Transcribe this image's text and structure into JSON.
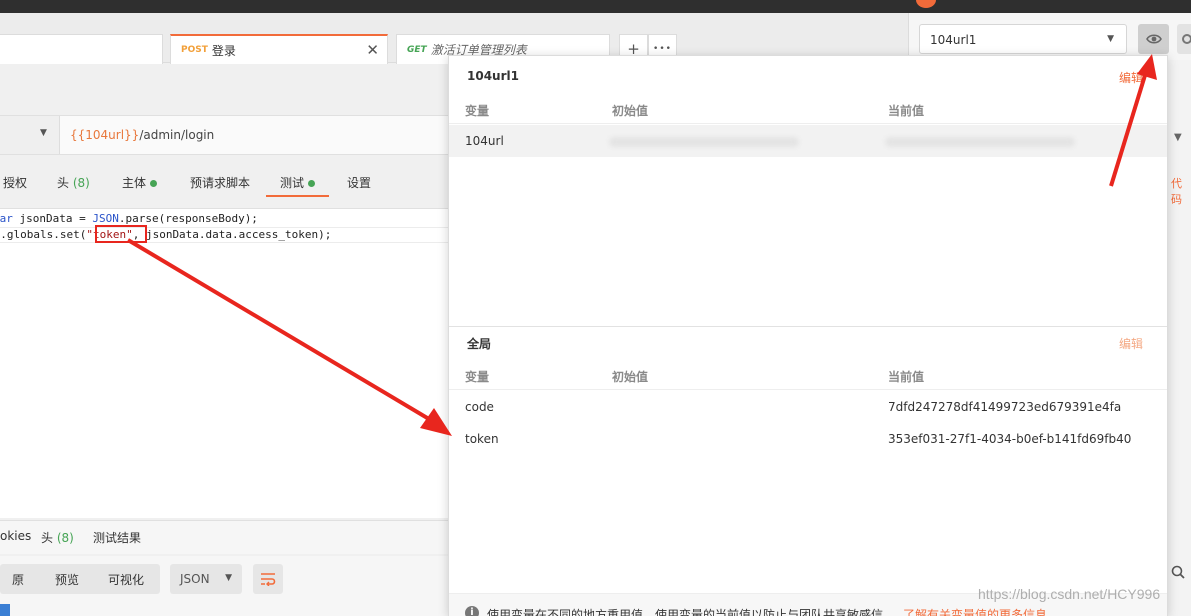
{
  "tabs": [
    {
      "method": "POST",
      "name": "登录",
      "active": true
    },
    {
      "method": "GET",
      "name": "激活订单管理列表",
      "active": false
    }
  ],
  "tab_close_glyph": "✕",
  "tab_add_glyph": "+",
  "tab_more_glyph": "•••",
  "request": {
    "url_var": "{{104url}}",
    "url_path": "/admin/login"
  },
  "request_tabs": {
    "auth": "授权",
    "headers": "头",
    "headers_count": "(8)",
    "body": "主体",
    "prerequest": "预请求脚本",
    "tests": "测试",
    "settings": "设置"
  },
  "code": {
    "line1_kw": "var",
    "line1_a": " jsonData = ",
    "line1_obj": "JSON",
    "line1_b": ".parse(responseBody);",
    "line2_a": "pm.globals.set(",
    "line2_str": "\"token\"",
    "line2_b": ", jsonData.data.access_token);"
  },
  "response_tabs": {
    "cookies": "okies",
    "headers": "头",
    "headers_count": "(8)",
    "test_results": "测试结果"
  },
  "response_tools": {
    "raw": "原",
    "preview": "预览",
    "visualize": "可视化",
    "format": "JSON"
  },
  "environment": {
    "selected": "104url1"
  },
  "popover": {
    "env_title": "104url1",
    "edit_label": "编辑",
    "col_variable": "变量",
    "col_initial": "初始值",
    "col_current": "当前值",
    "env_rows": [
      {
        "variable": "104url"
      }
    ],
    "globals_title": "全局",
    "global_rows": [
      {
        "variable": "code",
        "initial": "",
        "current": "7dfd247278df41499723ed679391e4fa"
      },
      {
        "variable": "token",
        "initial": "",
        "current": "353ef031-27f1-4034-b0ef-b141fd69fb40"
      }
    ],
    "footer_text": "使用变量在不同的地方重用值。使用变量的当前值以防止与团队共享敏感信",
    "footer_link": "了解有关变量值的更多信息"
  },
  "right_strip": {
    "code_text": "代码"
  },
  "watermark": "https://blog.csdn.net/HCY996",
  "colors": {
    "accent": "#f26b3a",
    "green": "#46a455",
    "arrow": "#e8261e"
  }
}
